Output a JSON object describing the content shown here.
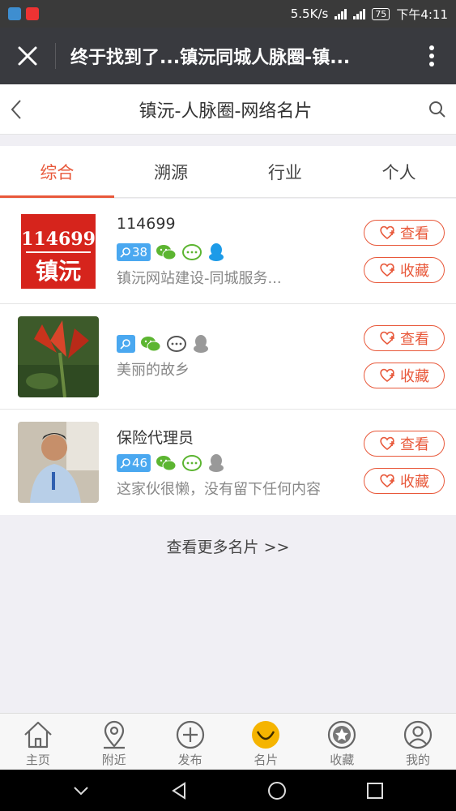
{
  "status_bar": {
    "speed": "5.5K/s",
    "network": "4G",
    "network2": "3G 2G",
    "battery": "75",
    "time": "下午4:11"
  },
  "titlebar": {
    "title": "终于找到了...镇沅同城人脉圈-镇...",
    "close_icon": "close-icon",
    "more_icon": "more-vertical-icon"
  },
  "page_header": {
    "title": "镇沅-人脉圈-网络名片",
    "back_icon": "chevron-left-icon",
    "search_icon": "search-icon"
  },
  "tabs": [
    {
      "label": "综合",
      "active": true
    },
    {
      "label": "溯源",
      "active": false
    },
    {
      "label": "行业",
      "active": false
    },
    {
      "label": "个人",
      "active": false
    }
  ],
  "cards": [
    {
      "name": "114699",
      "badge_count": "38",
      "desc": "镇沅网站建设-同城服务...",
      "avatar_text_top": "114699",
      "avatar_text_bottom": "镇沅",
      "wechat_active": true,
      "moments_active": true,
      "qq_active": true
    },
    {
      "name": "",
      "badge_count": "",
      "desc": "美丽的故乡",
      "wechat_active": true,
      "moments_active": false,
      "qq_active": false
    },
    {
      "name": "保险代理员",
      "badge_count": "46",
      "desc": "这家伙很懒，没有留下任何内容",
      "wechat_active": true,
      "moments_active": true,
      "qq_active": false
    }
  ],
  "actions": {
    "view_label": "查看",
    "fav_label": "收藏"
  },
  "more_link": "查看更多名片 >>",
  "bottom_nav": [
    {
      "label": "主页",
      "icon": "home-icon"
    },
    {
      "label": "附近",
      "icon": "location-pin-icon"
    },
    {
      "label": "发布",
      "icon": "plus-circle-icon"
    },
    {
      "label": "名片",
      "icon": "smile-icon"
    },
    {
      "label": "收藏",
      "icon": "star-circle-icon"
    },
    {
      "label": "我的",
      "icon": "user-circle-icon"
    }
  ],
  "colors": {
    "accent": "#e8583a",
    "titlebar": "#393a3f",
    "wechat_green": "#5cb531",
    "qq_blue": "#1d9be8",
    "badge_blue": "#4aa8f0",
    "nav_active": "#f5b400"
  }
}
